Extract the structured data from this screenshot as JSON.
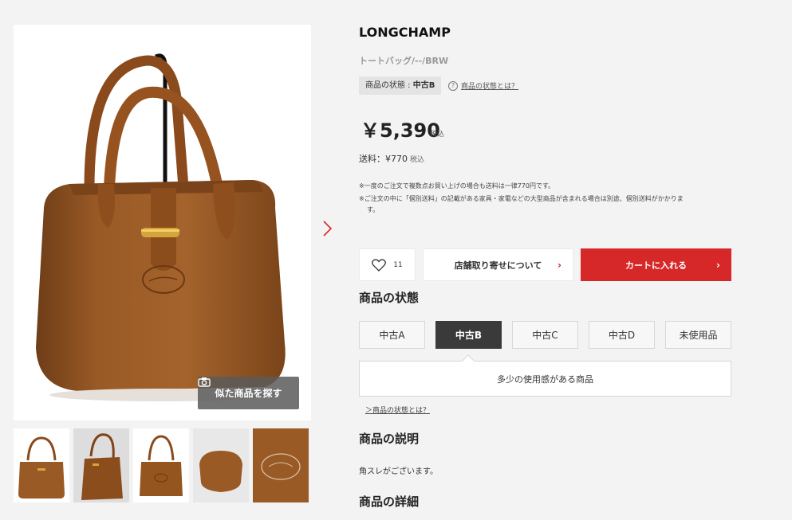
{
  "gallery": {
    "similar_label": "似た商品を探す",
    "thumb_count": 5
  },
  "product": {
    "brand": "LONGCHAMP",
    "subtitle": "トートバッグ/--/BRW",
    "condition_label": "商品の状態 : ",
    "condition_value": "中古B",
    "condition_help": "商品の状態とは？",
    "price": "￥5,390",
    "tax_label": "税込",
    "shipping": "送料：¥770",
    "shipping_tax": "税込",
    "note1": "※一度のご注文で複数点お買い上げの場合も送料は一律770円です。",
    "note2": "※ご注文の中に「個別送料」の記載がある家具・家電などの大型商品が含まれる場合は別途、個別送料がかかりま",
    "note3": "す。"
  },
  "actions": {
    "favorite_count": "11",
    "store_label": "店舗取り寄せについて",
    "cart_label": "カートに入れる"
  },
  "condition_section": {
    "title": "商品の状態",
    "grades": [
      "中古A",
      "中古B",
      "中古C",
      "中古D",
      "未使用品"
    ],
    "active_index": 1,
    "description": "多少の使用感がある商品",
    "link": "＞商品の状態とは？"
  },
  "description_section": {
    "title": "商品の説明",
    "text": "角スレがございます。"
  },
  "details_section": {
    "title": "商品の詳細"
  },
  "colors": {
    "accent_red": "#d62828",
    "bag_brown": "#8a4f22",
    "active_grade": "#3a3a3a"
  }
}
